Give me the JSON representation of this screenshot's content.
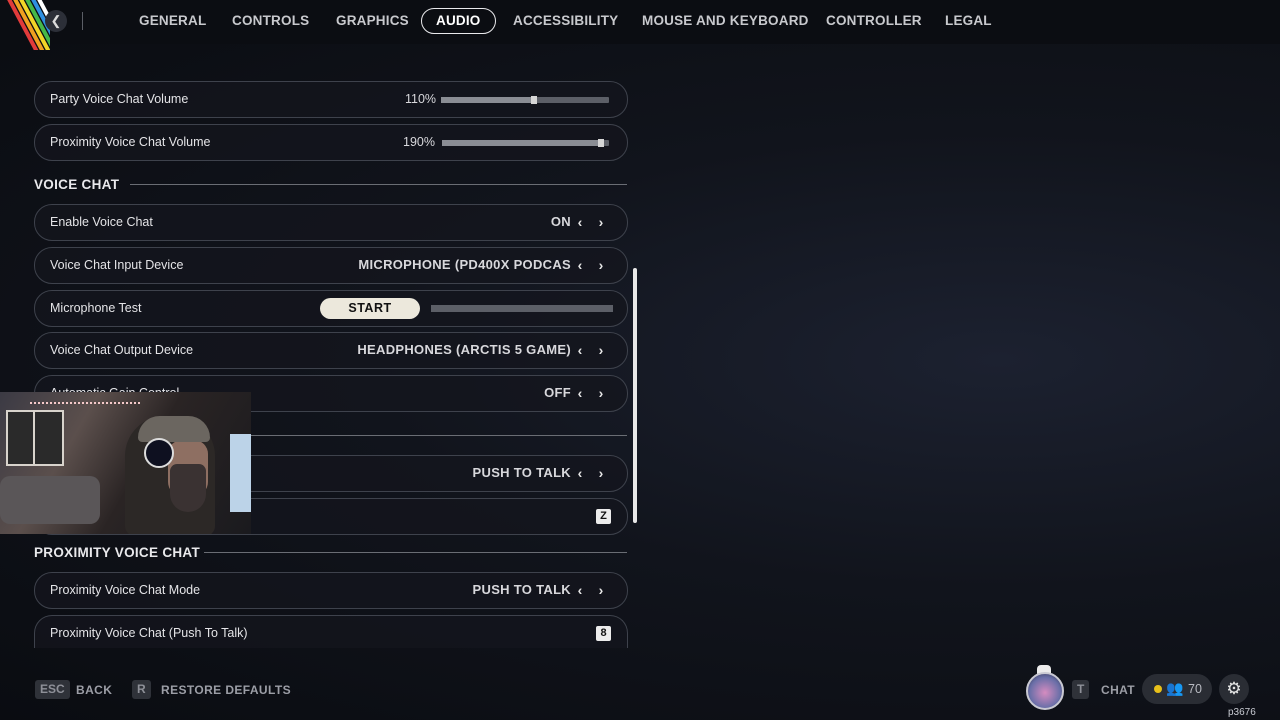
{
  "nav": {
    "tabs": [
      {
        "label": "GENERAL"
      },
      {
        "label": "CONTROLS"
      },
      {
        "label": "GRAPHICS"
      },
      {
        "label": "AUDIO",
        "active": true
      },
      {
        "label": "ACCESSIBILITY"
      },
      {
        "label": "MOUSE AND KEYBOARD"
      },
      {
        "label": "CONTROLLER"
      },
      {
        "label": "LEGAL"
      }
    ]
  },
  "audio": {
    "party_volume": {
      "label": "Party Voice Chat Volume",
      "value": "110%",
      "level": 0.55
    },
    "proximity_volume": {
      "label": "Proximity Voice Chat Volume",
      "value": "190%",
      "level": 0.95
    }
  },
  "voice_chat": {
    "heading": "VOICE CHAT",
    "enable": {
      "label": "Enable Voice Chat",
      "value": "ON"
    },
    "input_device": {
      "label": "Voice Chat Input Device",
      "value": "MICROPHONE (PD400X PODCAS"
    },
    "mic_test": {
      "label": "Microphone Test",
      "button": "START"
    },
    "output_device": {
      "label": "Voice Chat Output Device",
      "value": "HEADPHONES (ARCTIS 5 GAME)"
    },
    "agc": {
      "label": "Automatic Gain Control",
      "value": "OFF"
    },
    "mode": {
      "value": "PUSH TO TALK"
    },
    "ptt": {
      "key": "Z"
    }
  },
  "proximity_voice_chat": {
    "heading": "PROXIMITY VOICE CHAT",
    "mode": {
      "label": "Proximity Voice Chat Mode",
      "value": "PUSH TO TALK"
    },
    "ptt": {
      "label": "Proximity Voice Chat (Push To Talk)",
      "key": "8"
    }
  },
  "footer": {
    "back": {
      "key": "ESC",
      "label": "BACK"
    },
    "restore": {
      "key": "R",
      "label": "RESTORE DEFAULTS"
    },
    "chat": {
      "key": "T",
      "label": "CHAT"
    },
    "friends_count": "70",
    "player_id": "p3676"
  },
  "colors": {
    "stripes": [
      "#e23b3b",
      "#f0a020",
      "#f2d628",
      "#46b84a",
      "#2f8fe0",
      "#ffffff"
    ]
  }
}
